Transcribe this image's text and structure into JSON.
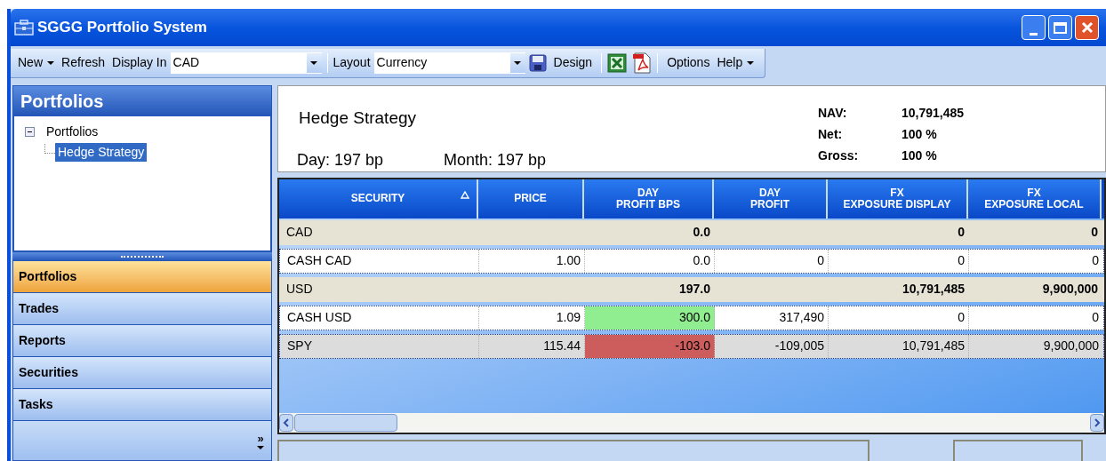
{
  "window": {
    "title": "SGGG Portfolio System"
  },
  "toolbar": {
    "new": "New",
    "refresh": "Refresh",
    "display_in_label": "Display In",
    "display_in_value": "CAD",
    "layout_label": "Layout",
    "layout_value": "Currency",
    "design": "Design",
    "options": "Options",
    "help": "Help"
  },
  "sidebar": {
    "title": "Portfolios",
    "tree": [
      {
        "label": "Portfolios",
        "expanded": true,
        "selected": false,
        "children": [
          {
            "label": "Hedge Strategy",
            "selected": true
          }
        ]
      }
    ],
    "nav": [
      {
        "label": "Portfolios",
        "selected": true
      },
      {
        "label": "Trades",
        "selected": false
      },
      {
        "label": "Reports",
        "selected": false
      },
      {
        "label": "Securities",
        "selected": false
      },
      {
        "label": "Tasks",
        "selected": false
      }
    ],
    "more": "»"
  },
  "summary": {
    "name": "Hedge Strategy",
    "day": "Day: 197 bp",
    "month": "Month: 197 bp",
    "stats": [
      {
        "label": "NAV:",
        "value": "10,791,485"
      },
      {
        "label": "Net:",
        "value": "100 %"
      },
      {
        "label": "Gross:",
        "value": "100 %"
      }
    ]
  },
  "table": {
    "columns": [
      {
        "label": "SECURITY",
        "sorted": true
      },
      {
        "label": "PRICE",
        "sorted": false
      },
      {
        "label": "DAY\nPROFIT BPS",
        "sorted": false
      },
      {
        "label": "DAY\nPROFIT",
        "sorted": false
      },
      {
        "label": "FX\nEXPOSURE DISPLAY",
        "sorted": false
      },
      {
        "label": "FX\nEXPOSURE LOCAL",
        "sorted": false
      }
    ],
    "rows": [
      {
        "kind": "group",
        "label": "CAD",
        "day_profit_bps": "0.0",
        "fx_exposure_display": "0",
        "fx_exposure_local": "0"
      },
      {
        "kind": "row",
        "selected": false,
        "cells": [
          "CASH CAD",
          "1.00",
          "0.0",
          "0",
          "0",
          "0"
        ]
      },
      {
        "kind": "group",
        "label": "USD",
        "day_profit_bps": "197.0",
        "fx_exposure_display": "10,791,485",
        "fx_exposure_local": "9,900,000"
      },
      {
        "kind": "row",
        "selected": false,
        "color": "#90ee90",
        "cells": [
          "CASH USD",
          "1.09",
          "300.0",
          "317,490",
          "0",
          "0"
        ]
      },
      {
        "kind": "row",
        "selected": true,
        "color": "#cd5c5c",
        "cells": [
          "SPY",
          "115.44",
          "-103.0",
          "-109,005",
          "10,791,485",
          "9,900,000"
        ]
      }
    ]
  }
}
